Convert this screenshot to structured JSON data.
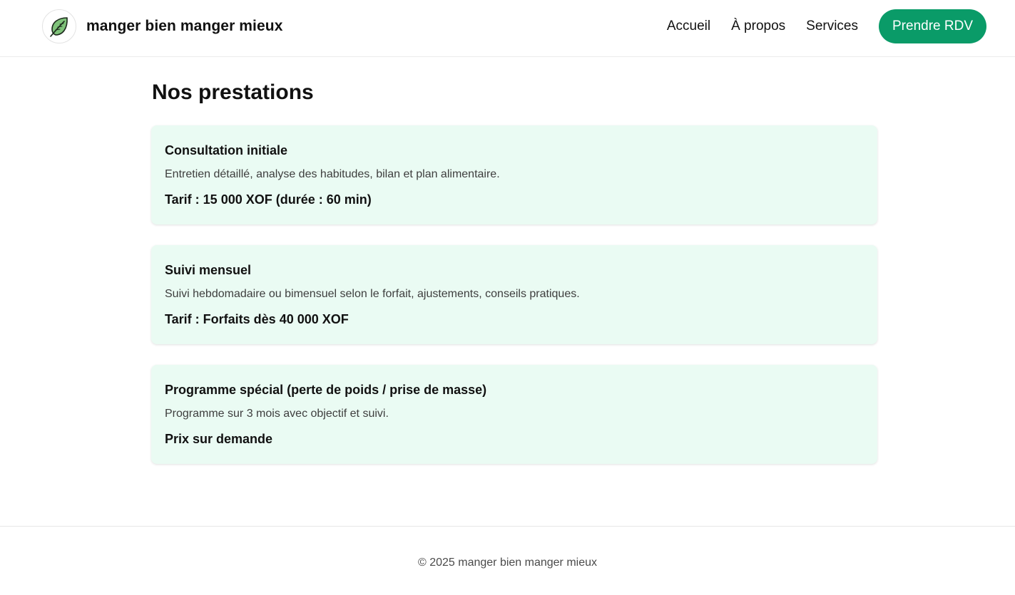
{
  "header": {
    "brand_name": "manger bien manger mieux",
    "logo_icon": "leaf-icon",
    "nav": [
      {
        "label": "Accueil"
      },
      {
        "label": "À propos"
      },
      {
        "label": "Services"
      }
    ],
    "cta_label": "Prendre RDV"
  },
  "main": {
    "title": "Nos prestations",
    "services": [
      {
        "title": "Consultation initiale",
        "description": "Entretien détaillé, analyse des habitudes, bilan et plan alimentaire.",
        "price": "Tarif : 15 000 XOF (durée : 60 min)"
      },
      {
        "title": "Suivi mensuel",
        "description": "Suivi hebdomadaire ou bimensuel selon le forfait, ajustements, conseils pratiques.",
        "price": "Tarif : Forfaits dès 40 000 XOF"
      },
      {
        "title": "Programme spécial (perte de poids / prise de masse)",
        "description": "Programme sur 3 mois avec objectif et suivi.",
        "price": "Prix sur demande"
      }
    ]
  },
  "footer": {
    "text": "© 2025 manger bien manger mieux"
  },
  "colors": {
    "accent": "#0a9b68",
    "card_background": "#eafbf3",
    "leaf_fill": "#7fc27a"
  }
}
